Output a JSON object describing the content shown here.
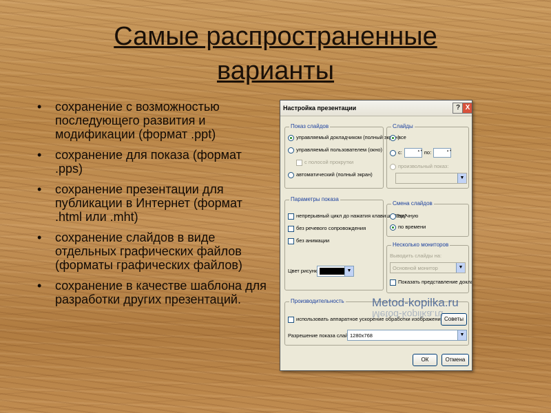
{
  "slide": {
    "title_line1": "Самые распространенные",
    "title_line2": "варианты",
    "bullets": [
      "сохранение  с возможностью последующего развития и модификации (формат .ppt)",
      "сохранение  для показа (формат .pps)",
      "сохранение  презентации для публикации в Интернет (формат .html или .mht)",
      "сохранение  слайдов в виде отдельных графических файлов (форматы графических файлов)",
      "сохранение  в качестве шаблона для разработки других презентаций."
    ],
    "bullet_char": "•"
  },
  "dialog": {
    "title": "Настройка презентации",
    "help_label": "?",
    "close_label": "X",
    "show_type": {
      "label": "Показ слайдов",
      "options": [
        "управляемый докладчиком (полный экран)",
        "управляемый пользователем (окно)",
        "с полосой прокрутки",
        "автоматический (полный экран)"
      ],
      "selected": 0
    },
    "slides": {
      "label": "Слайды",
      "all_label": "все",
      "from_label": "с:",
      "to_label": "по:",
      "custom_label": "произвольный показ:"
    },
    "show_options": {
      "label": "Параметры показа",
      "options": [
        "непрерывный цикл до нажатия клавиши \"Esc\"",
        "без речевого сопровождения",
        "без анимации"
      ],
      "pen_color_label": "Цвет рисунка:",
      "pen_color": "#000000"
    },
    "advance": {
      "label": "Смена слайдов",
      "options": [
        "вручную",
        "по времени"
      ],
      "selected": 1
    },
    "monitors": {
      "label": "Несколько мониторов",
      "display_on_label": "Выводить слайды на:",
      "display_on_value": "Основной монитор",
      "presenter_view_label": "Показать представление докладчика"
    },
    "performance": {
      "label": "Производительность",
      "hw_accel_label": "использовать аппаратное ускорение обработки изображений",
      "tips_button": "Советы",
      "resolution_label": "Разрешение показа слайдов:",
      "resolution_value": "1280x768"
    },
    "ok_button": "ОК",
    "cancel_button": "Отмена"
  },
  "watermark": "Metod-kopilka.ru"
}
